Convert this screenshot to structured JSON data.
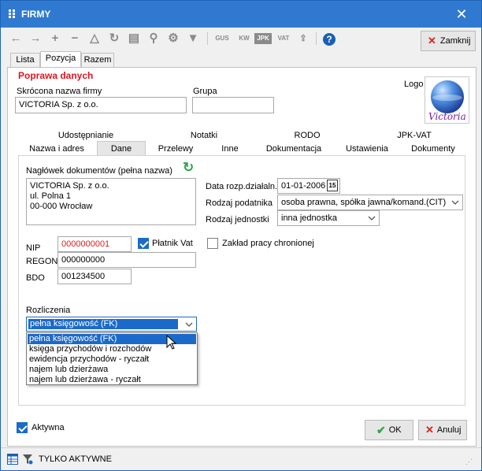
{
  "window": {
    "title": "FIRMY",
    "close_glyph": "✕"
  },
  "toolbar": {
    "icons": [
      "arrow-left-icon",
      "arrow-right-icon",
      "plus-icon",
      "minus-icon",
      "warning-icon",
      "refresh-icon",
      "print-icon",
      "zoom-icon",
      "settings-icon",
      "filter-icon"
    ],
    "text_icons": {
      "gus": "GUS",
      "kw": "KW",
      "jpk": "JPK",
      "vat": "VAT"
    },
    "close_label": "Zamknij"
  },
  "tabs": [
    {
      "label": "Lista"
    },
    {
      "label": "Pozycja",
      "active": true
    },
    {
      "label": "Razem"
    }
  ],
  "section_title": "Poprawa danych",
  "short_name": {
    "label": "Skrócona nazwa firmy",
    "value": "VICTORIA Sp. z o.o."
  },
  "group": {
    "label": "Grupa",
    "value": ""
  },
  "logo": {
    "label": "Logo",
    "text": "Victoria"
  },
  "subtabs_row1": [
    {
      "label": "Udostępnianie"
    },
    {
      "label": "Notatki"
    },
    {
      "label": "RODO"
    },
    {
      "label": "JPK-VAT"
    }
  ],
  "subtabs_row2": [
    {
      "label": "Nazwa i adres"
    },
    {
      "label": "Dane",
      "active": true
    },
    {
      "label": "Przelewy"
    },
    {
      "label": "Inne"
    },
    {
      "label": "Dokumentacja"
    },
    {
      "label": "Ustawienia"
    },
    {
      "label": "Dokumenty"
    }
  ],
  "header_docs": {
    "label": "Nagłówek dokumentów (pełna nazwa)",
    "lines": [
      "VICTORIA Sp. z o.o.",
      "ul. Polna 1",
      "00-000 Wrocław"
    ]
  },
  "start_date": {
    "label": "Data rozp.działaln.",
    "value": "01-01-2006",
    "cal": "15"
  },
  "taxpayer_type": {
    "label": "Rodzaj podatnika",
    "value": "osoba prawna, spółka jawna/komand.(CIT)"
  },
  "unit_type": {
    "label": "Rodzaj jednostki",
    "value": "inna jednostka"
  },
  "nip": {
    "label": "NIP",
    "value": "0000000001"
  },
  "vat_payer": {
    "label": "Płatnik Vat",
    "checked": true
  },
  "sheltered": {
    "label": "Zakład pracy chronionej",
    "checked": false
  },
  "regon": {
    "label": "REGON",
    "value": "000000000"
  },
  "bdo": {
    "label": "BDO",
    "value": "001234500"
  },
  "settlement": {
    "label": "Rozliczenia",
    "selected": "pełna księgowość (FK)",
    "options": [
      "pełna księgowość (FK)",
      "księga przychodów i rozchodów",
      "ewidencja przychodów - ryczałt",
      "najem lub dzierżawa",
      "najem lub dzierżawa - ryczałt"
    ]
  },
  "active": {
    "label": "Aktywna",
    "checked": true
  },
  "buttons": {
    "ok": "OK",
    "cancel": "Anuluj"
  },
  "status": {
    "text": "TYLKO AKTYWNE"
  },
  "colors": {
    "titlebar": "#2f7ad0",
    "accent": "#1b6ac9",
    "red": "#e0141c",
    "green": "#2ea44f"
  }
}
